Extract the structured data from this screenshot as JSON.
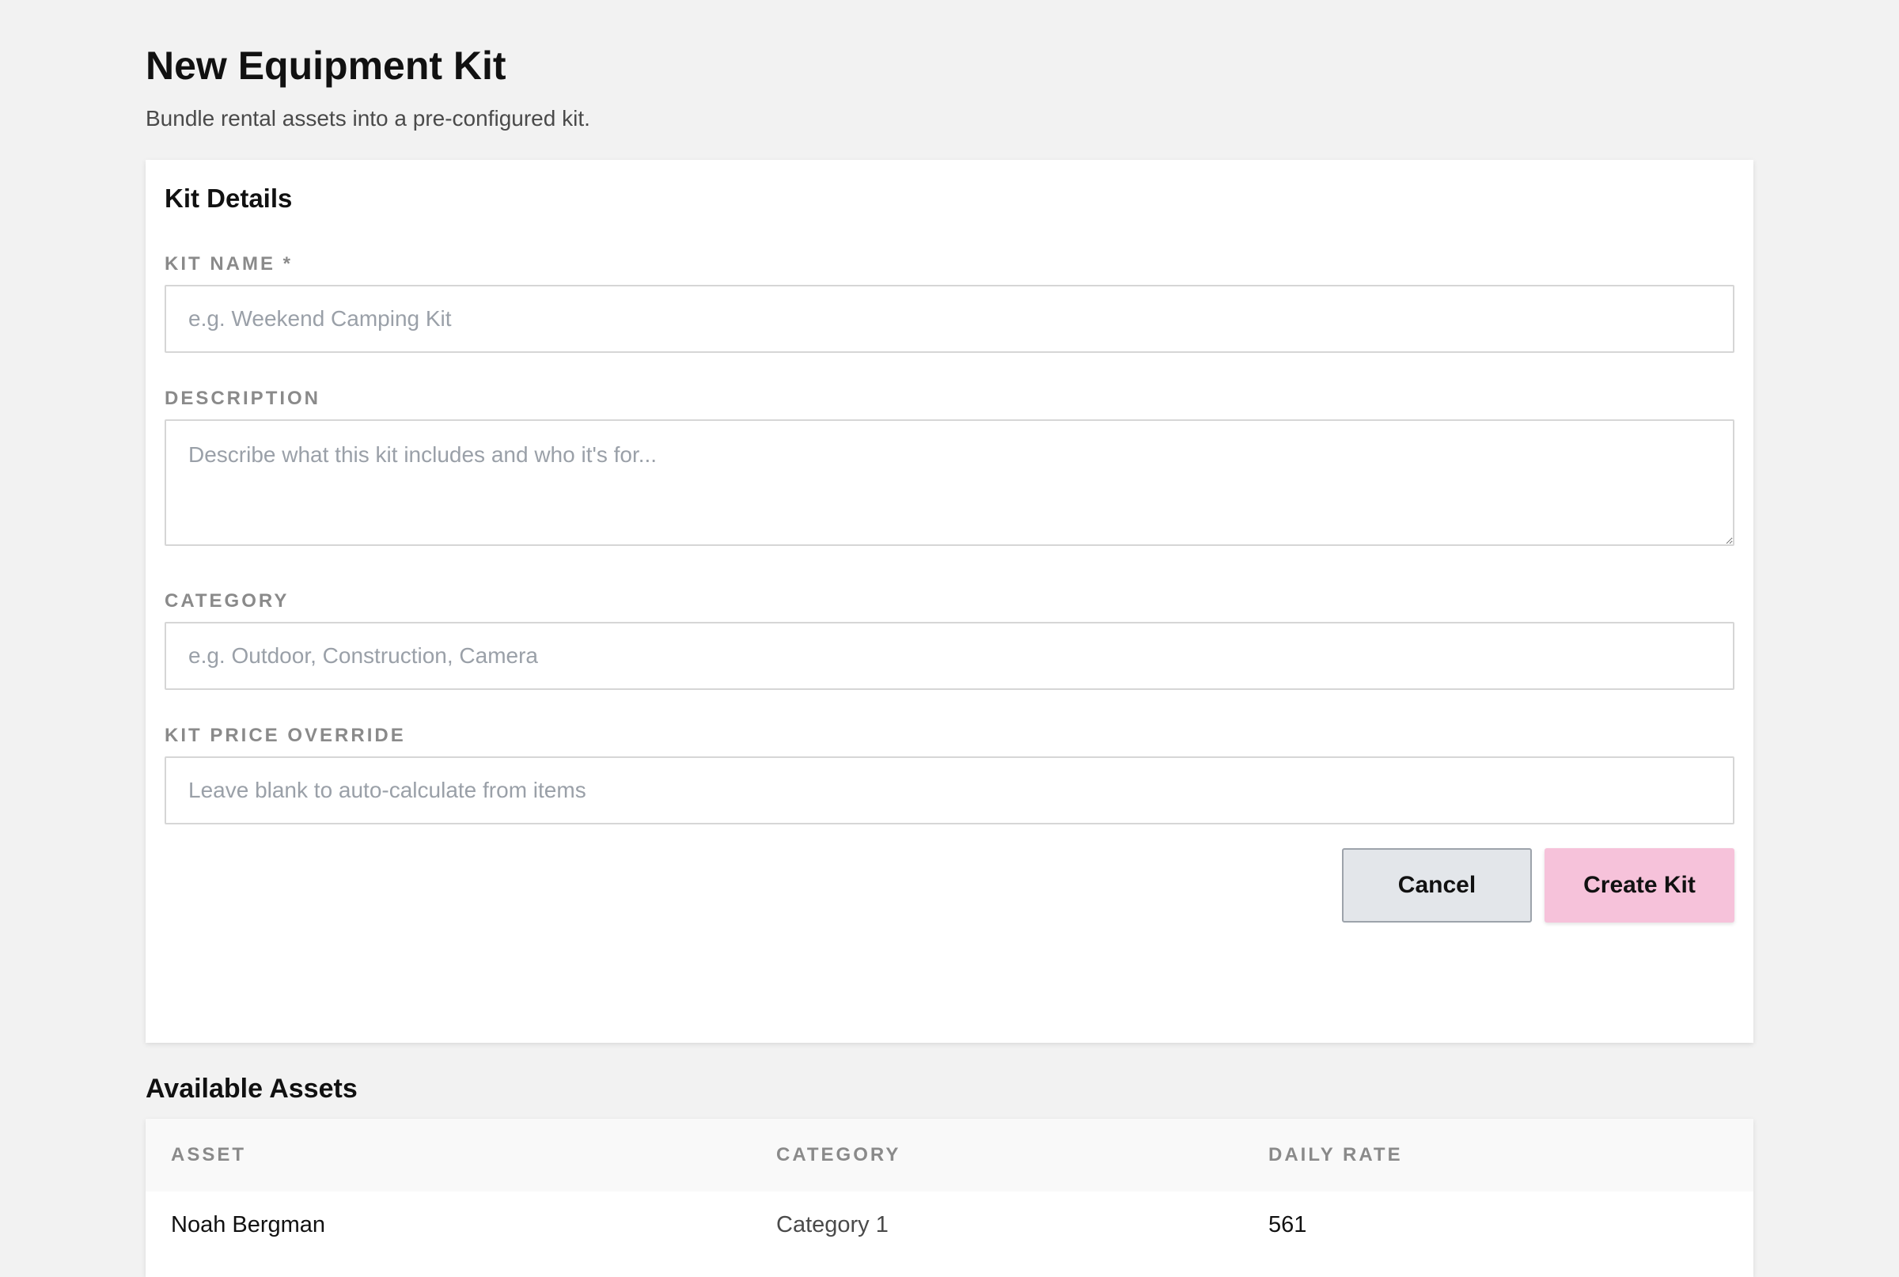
{
  "header": {
    "title": "New Equipment Kit",
    "subtitle": "Bundle rental assets into a pre-configured kit."
  },
  "form": {
    "section_title": "Kit Details",
    "fields": {
      "kit_name": {
        "label": "KIT NAME *",
        "value": "",
        "placeholder": "e.g. Weekend Camping Kit"
      },
      "description": {
        "label": "DESCRIPTION",
        "value": "",
        "placeholder": "Describe what this kit includes and who it's for..."
      },
      "category": {
        "label": "CATEGORY",
        "value": "",
        "placeholder": "e.g. Outdoor, Construction, Camera"
      },
      "price_override": {
        "label": "KIT PRICE OVERRIDE",
        "value": "",
        "placeholder": "Leave blank to auto-calculate from items"
      }
    },
    "buttons": {
      "cancel": "Cancel",
      "create": "Create Kit"
    }
  },
  "assets": {
    "title": "Available Assets",
    "columns": [
      "ASSET",
      "CATEGORY",
      "DAILY RATE"
    ],
    "rows": [
      {
        "asset": "Noah Bergman",
        "category": "Category 1",
        "daily_rate": "561"
      }
    ]
  },
  "colors": {
    "background": "#f2f2f2",
    "card": "#ffffff",
    "primary_button": "#f6c2da",
    "secondary_button": "#e3e6ea",
    "label_text": "#8a8a8a",
    "placeholder_text": "#9aa0a8"
  }
}
